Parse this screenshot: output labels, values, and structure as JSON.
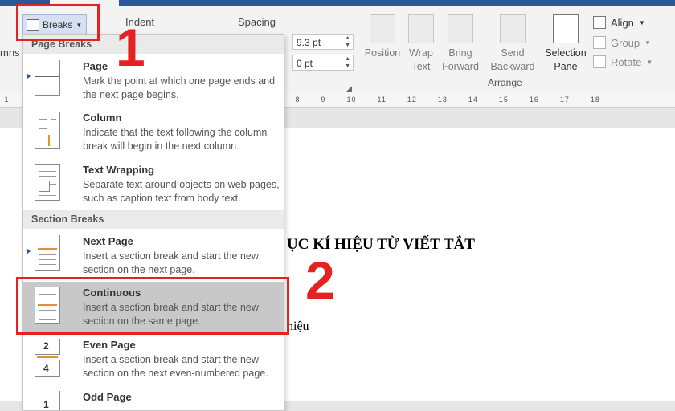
{
  "ribbon": {
    "breaks_label": "Breaks",
    "indent_label": "Indent",
    "spacing_label": "Spacing",
    "spacing_before": "9.3 pt",
    "spacing_after": "0 pt",
    "columns_partial": "mns",
    "position_label": "Position",
    "wrap_text_line1": "Wrap",
    "wrap_text_line2": "Text",
    "bring_forward_line1": "Bring",
    "bring_forward_line2": "Forward",
    "send_backward_line1": "Send",
    "send_backward_line2": "Backward",
    "selection_pane_line1": "Selection",
    "selection_pane_line2": "Pane",
    "align_label": "Align",
    "group_label": "Group",
    "rotate_label": "Rotate",
    "arrange_group_label": "Arrange"
  },
  "annotations": {
    "step1": "1",
    "step2": "2"
  },
  "ruler": {
    "marks": "· 8 · · · 9 · · · 10 · · · 11 · · · 12 · · · 13 · · · 14 · · · 15 · · · 16 · · · 17 · · · 18 ·"
  },
  "document": {
    "heading": "ỤC KÍ HIỆU TỪ VIẾT TẮT",
    "text": "hiệu"
  },
  "menu": {
    "page_breaks_header": "Page Breaks",
    "section_breaks_header": "Section Breaks",
    "items": [
      {
        "title": "Page",
        "desc": "Mark the point at which one page ends and the next page begins."
      },
      {
        "title": "Column",
        "desc": "Indicate that the text following the column break will begin in the next column."
      },
      {
        "title": "Text Wrapping",
        "desc": "Separate text around objects on web pages, such as caption text from body text."
      },
      {
        "title": "Next Page",
        "desc": "Insert a section break and start the new section on the next page."
      },
      {
        "title": "Continuous",
        "desc": "Insert a section break and start the new section on the same page."
      },
      {
        "title": "Even Page",
        "desc": "Insert a section break and start the new section on the next even-numbered page."
      },
      {
        "title": "Odd Page",
        "desc": ""
      }
    ],
    "even_icon_num_1": "2",
    "even_icon_num_2": "4",
    "odd_icon_num": "1"
  },
  "colors": {
    "annotation_red": "#e52222",
    "highlight_gray": "#c8c8c8",
    "accent_orange": "#e8912a"
  }
}
